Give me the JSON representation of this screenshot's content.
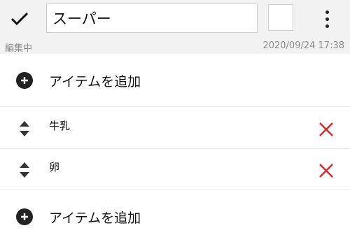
{
  "header": {
    "confirm_icon": "check-icon",
    "title_value": "スーパー",
    "color_swatch": "#ffffff",
    "menu_icon": "more-vert-icon"
  },
  "status": {
    "mode": "編集中",
    "timestamp": "2020/09/24 17:38"
  },
  "add_item_label": "アイテムを追加",
  "items": [
    {
      "label": "牛乳"
    },
    {
      "label": "卵"
    }
  ],
  "colors": {
    "delete": "#d32f2f",
    "toolbar_bg": "#f2f2f2"
  }
}
